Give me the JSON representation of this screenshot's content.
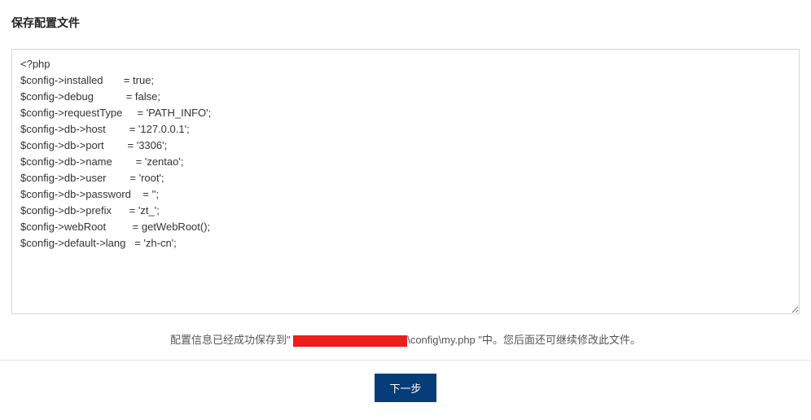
{
  "header": {
    "title": "保存配置文件"
  },
  "config": {
    "text": "<?php\n$config->installed       = true;\n$config->debug           = false;\n$config->requestType     = 'PATH_INFO';\n$config->db->host        = '127.0.0.1';\n$config->db->port        = '3306';\n$config->db->name        = 'zentao';\n$config->db->user        = 'root';\n$config->db->password    = '';\n$config->db->prefix      = 'zt_';\n$config->webRoot         = getWebRoot();\n$config->default->lang   = 'zh-cn';"
  },
  "status": {
    "prefix": "配置信息已经成功保存到\" ",
    "path_tail": "\\config\\my.php \"中。您后面还可继续修改此文件。"
  },
  "buttons": {
    "next": "下一步"
  }
}
